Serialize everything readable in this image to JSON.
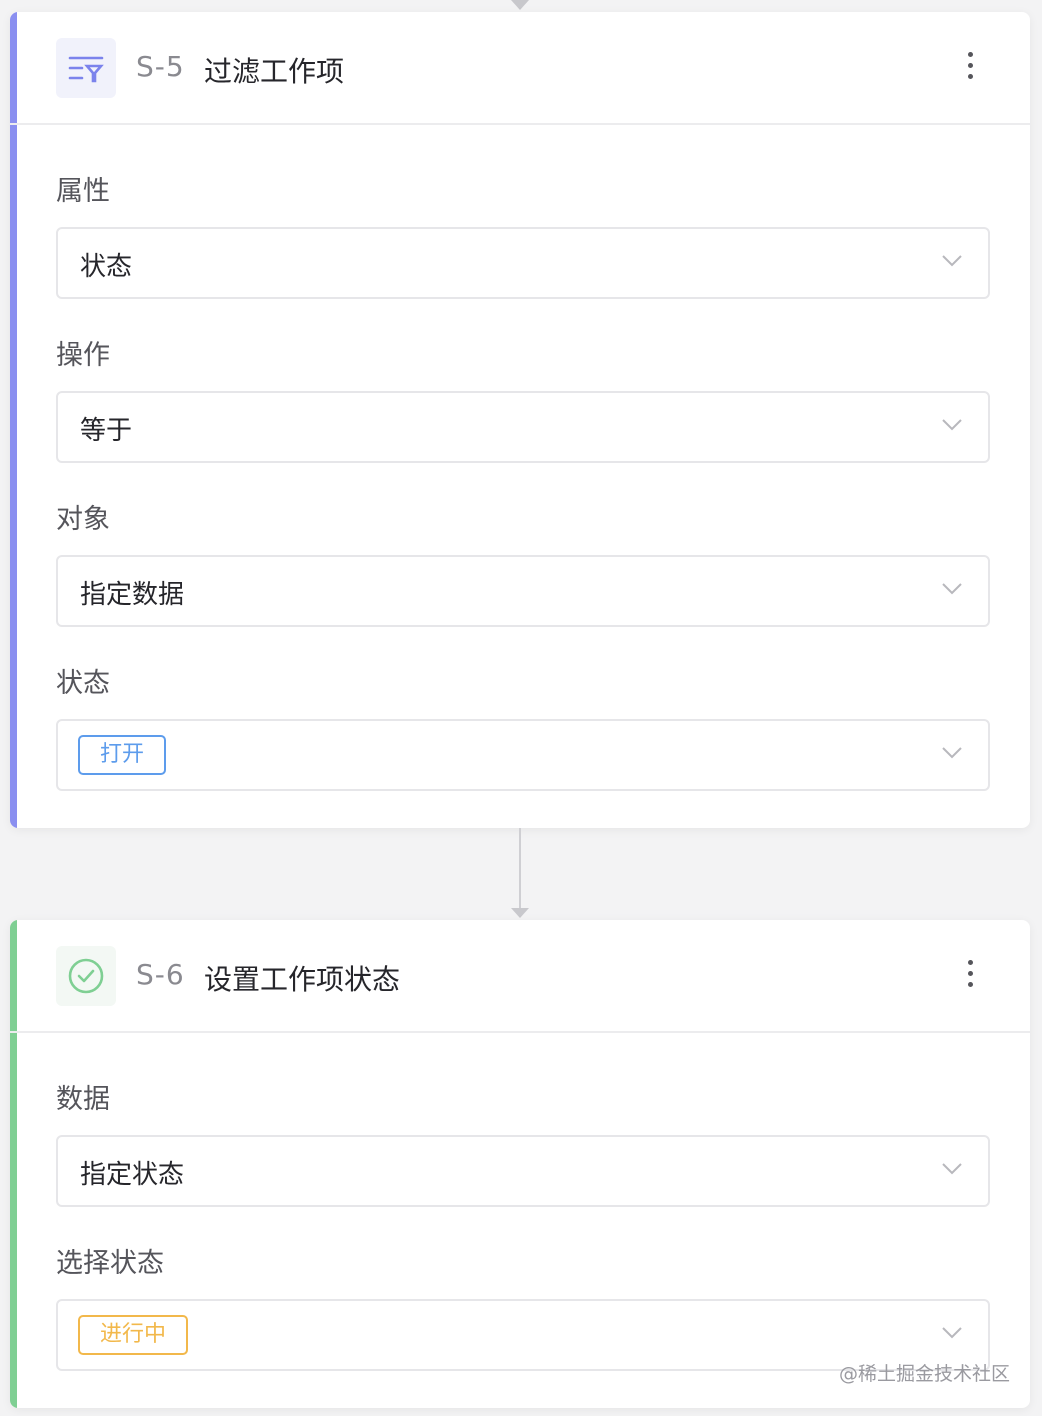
{
  "card1": {
    "accent_color": "#8a8ff0",
    "icon": "filter-list-icon",
    "icon_bg": "#f1f2fb",
    "step_id": "S-5",
    "title": "过滤工作项",
    "fields": [
      {
        "label": "属性",
        "value": "状态"
      },
      {
        "label": "操作",
        "value": "等于"
      },
      {
        "label": "对象",
        "value": "指定数据"
      }
    ],
    "status_field": {
      "label": "状态",
      "tag": "打开",
      "tag_color": "#5d9cec"
    }
  },
  "card2": {
    "accent_color": "#7fcf93",
    "icon": "check-circle-icon",
    "icon_bg": "#f3f8f4",
    "step_id": "S-6",
    "title": "设置工作项状态",
    "fields": [
      {
        "label": "数据",
        "value": "指定状态"
      }
    ],
    "status_field": {
      "label": "选择状态",
      "tag": "进行中",
      "tag_color": "#f2b84b"
    }
  },
  "watermark": "@稀土掘金技术社区"
}
